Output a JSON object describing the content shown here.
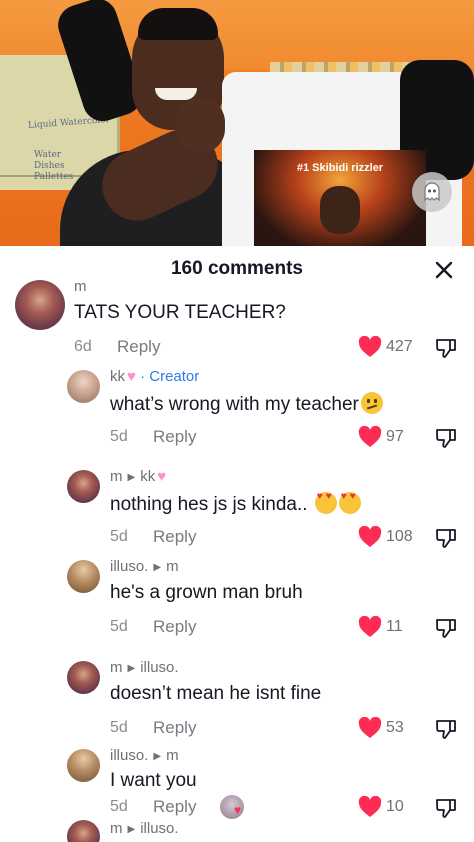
{
  "video": {
    "shirt_print_text": "#1 Skibidi rizzler",
    "cabinet_label_1": "Liquid Watercolor",
    "cabinet_label_2": "Water Dishes Pallettes"
  },
  "sheet": {
    "title": "160 comments"
  },
  "icons": {
    "close": "close-icon",
    "like": "heart-icon",
    "dislike": "dislike-icon"
  },
  "colors": {
    "like_heart": "#fe2c55",
    "creator_badge": "#2b7de9"
  },
  "comments": [
    {
      "username": "m",
      "text": "TATS YOUR TEACHER?",
      "age": "6d",
      "reply_label": "Reply",
      "likes": "427"
    },
    {
      "username": "kk",
      "badge": "· Creator",
      "text": "what’s wrong with my teacher",
      "age": "5d",
      "reply_label": "Reply",
      "likes": "97"
    },
    {
      "username": "m",
      "reply_to": "kk",
      "text": "nothing hes js js kinda..",
      "age": "5d",
      "reply_label": "Reply",
      "likes": "108"
    },
    {
      "username": "illuso.",
      "reply_to": "m",
      "text": "he's a grown man bruh",
      "age": "5d",
      "reply_label": "Reply",
      "likes": "11"
    },
    {
      "username": "m",
      "reply_to": "illuso.",
      "text": "doesn’t mean he isnt fine",
      "age": "5d",
      "reply_label": "Reply",
      "likes": "53"
    },
    {
      "username": "illuso.",
      "reply_to": "m",
      "text": "I want you",
      "age": "5d",
      "reply_label": "Reply",
      "likes": "10"
    },
    {
      "username": "m",
      "reply_to": "illuso."
    }
  ]
}
